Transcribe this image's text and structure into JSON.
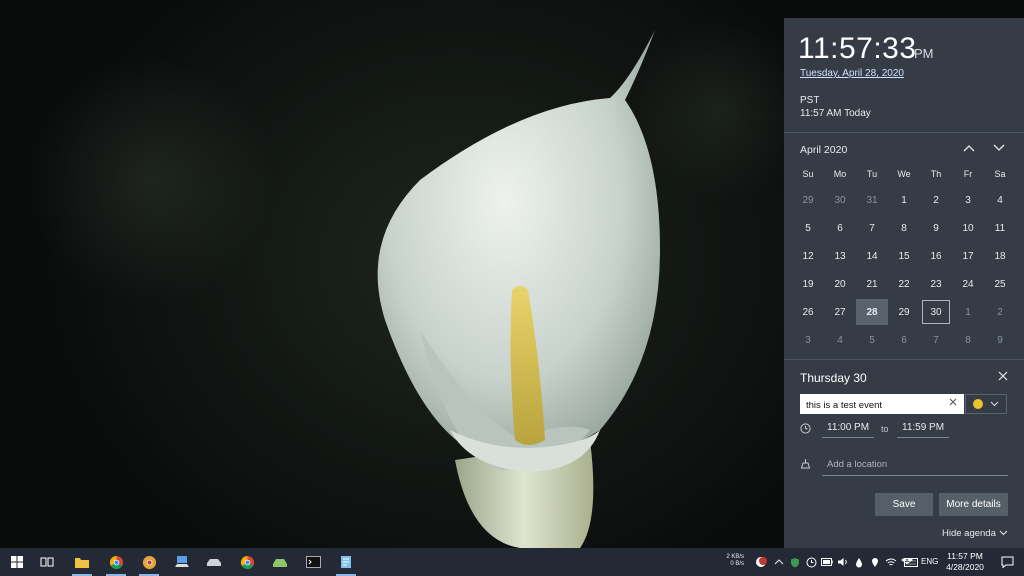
{
  "flyout": {
    "time": "11:57:33",
    "ampm": "PM",
    "date": "Tuesday, April 28, 2020",
    "timezone": "PST",
    "timezone_time": "11:57 AM Today",
    "calendar": {
      "month_label": "April 2020",
      "weekdays": [
        "Su",
        "Mo",
        "Tu",
        "We",
        "Th",
        "Fr",
        "Sa"
      ],
      "days": [
        {
          "n": "29",
          "muted": true
        },
        {
          "n": "30",
          "muted": true
        },
        {
          "n": "31",
          "muted": true
        },
        {
          "n": "1"
        },
        {
          "n": "2"
        },
        {
          "n": "3"
        },
        {
          "n": "4"
        },
        {
          "n": "5"
        },
        {
          "n": "6"
        },
        {
          "n": "7"
        },
        {
          "n": "8"
        },
        {
          "n": "9"
        },
        {
          "n": "10"
        },
        {
          "n": "11"
        },
        {
          "n": "12"
        },
        {
          "n": "13"
        },
        {
          "n": "14"
        },
        {
          "n": "15"
        },
        {
          "n": "16"
        },
        {
          "n": "17"
        },
        {
          "n": "18"
        },
        {
          "n": "19"
        },
        {
          "n": "20"
        },
        {
          "n": "21"
        },
        {
          "n": "22"
        },
        {
          "n": "23"
        },
        {
          "n": "24"
        },
        {
          "n": "25"
        },
        {
          "n": "26"
        },
        {
          "n": "27"
        },
        {
          "n": "28",
          "today": true
        },
        {
          "n": "29"
        },
        {
          "n": "30",
          "selected": true
        },
        {
          "n": "1",
          "muted": true
        },
        {
          "n": "2",
          "muted": true
        },
        {
          "n": "3",
          "muted": true
        },
        {
          "n": "4",
          "muted": true
        },
        {
          "n": "5",
          "muted": true
        },
        {
          "n": "6",
          "muted": true
        },
        {
          "n": "7",
          "muted": true
        },
        {
          "n": "8",
          "muted": true
        },
        {
          "n": "9",
          "muted": true
        }
      ]
    },
    "agenda": {
      "title": "Thursday 30",
      "event_value": "this is a test event",
      "start_time": "11:00 PM",
      "to_label": "to",
      "end_time": "11:59 PM",
      "location_placeholder": "Add a location",
      "save_label": "Save",
      "more_details_label": "More details",
      "hide_agenda_label": "Hide agenda",
      "event_color": "#e8c52a"
    }
  },
  "taskbar": {
    "net_up": "2 KB/s",
    "net_down": "0 B/s",
    "language": "ENG",
    "clock_time": "11:57 PM",
    "clock_date": "4/28/2020"
  }
}
